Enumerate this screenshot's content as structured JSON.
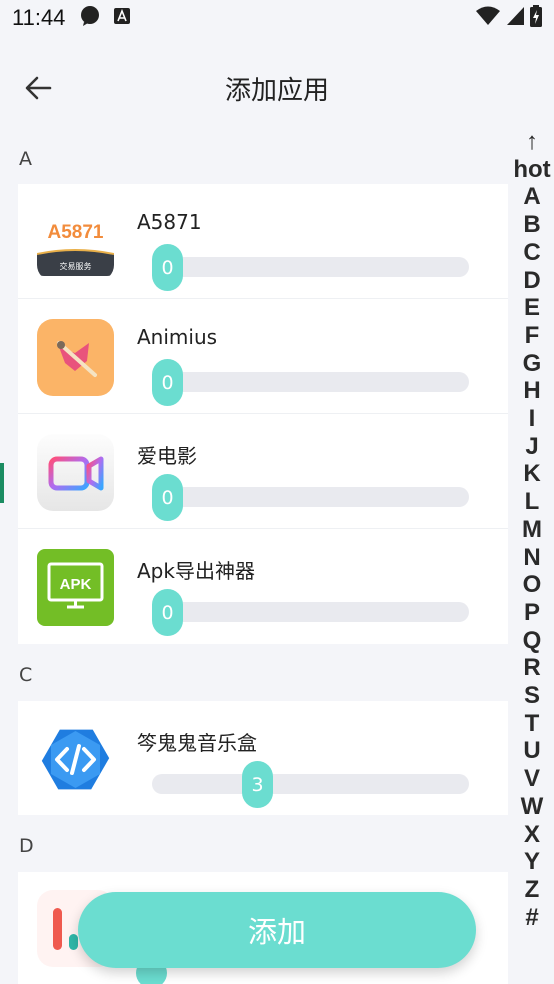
{
  "status_bar": {
    "time": "11:44"
  },
  "header": {
    "title": "添加应用"
  },
  "sections": [
    {
      "letter": "A",
      "apps": [
        {
          "name": "A5871",
          "value": "0",
          "icon_text": "A5871",
          "icon_sub": "交易服务"
        },
        {
          "name": "Animius",
          "value": "0"
        },
        {
          "name": "爱电影",
          "value": "0"
        },
        {
          "name": "Apk导出神器",
          "value": "0",
          "icon_text": "APK"
        }
      ]
    },
    {
      "letter": "C",
      "apps": [
        {
          "name": "笒鬼鬼音乐盒",
          "value": "3"
        }
      ]
    },
    {
      "letter": "D",
      "apps": []
    }
  ],
  "index_bar": [
    "↑",
    "hot",
    "A",
    "B",
    "C",
    "D",
    "E",
    "F",
    "G",
    "H",
    "I",
    "J",
    "K",
    "L",
    "M",
    "N",
    "O",
    "P",
    "Q",
    "R",
    "S",
    "T",
    "U",
    "V",
    "W",
    "X",
    "Y",
    "Z",
    "#"
  ],
  "add_button": {
    "label": "添加"
  },
  "colors": {
    "accent": "#6bddd0",
    "track": "#e9eaef"
  }
}
